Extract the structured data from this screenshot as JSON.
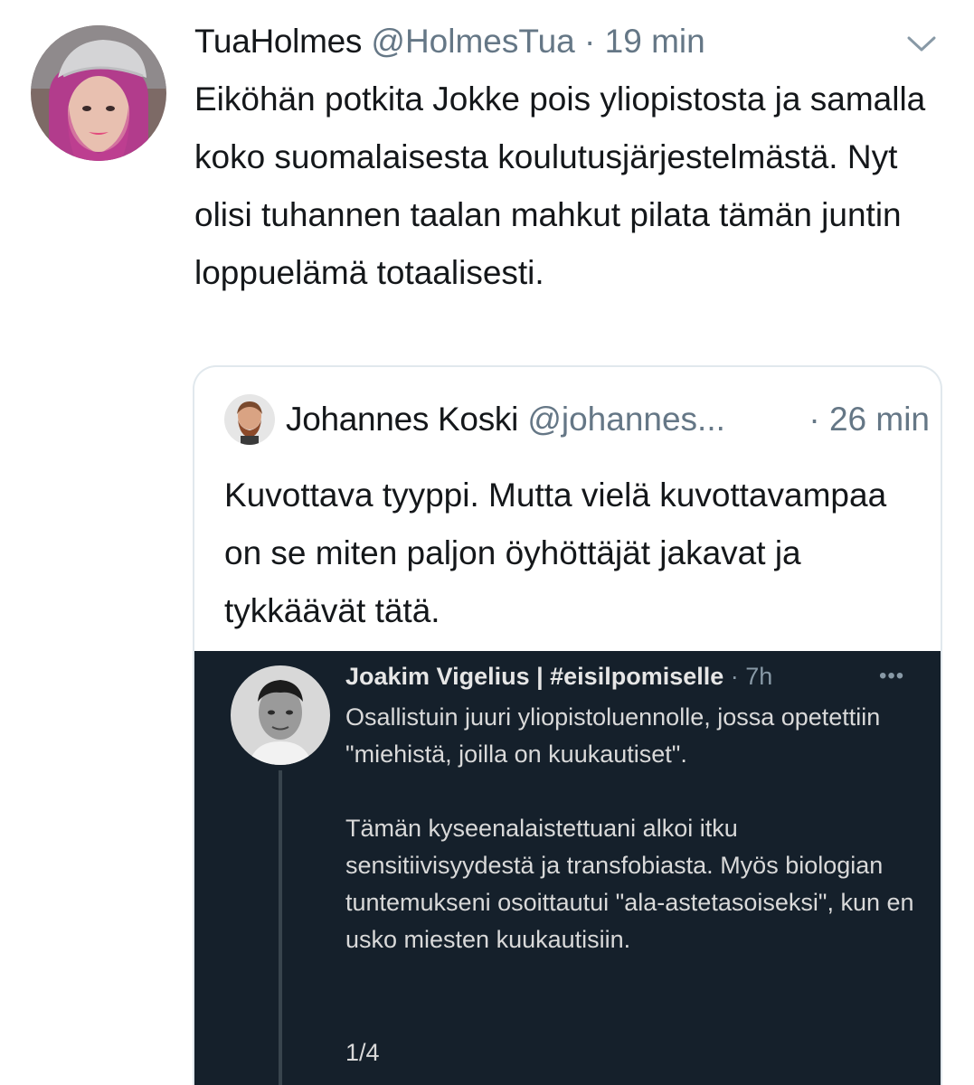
{
  "tweet": {
    "display_name": "TuaHolmes",
    "handle": "@HolmesTua",
    "separator": "·",
    "time": "19 min",
    "more_icon": "chevron-down-icon",
    "text": "Eiköhän potkita Jokke pois yliopistosta ja samalla koko suomalaisesta koulutusjärjestelmästä. Nyt olisi tuhannen taalan mahkut pilata tämän juntin loppuelämä totaalisesti."
  },
  "quote": {
    "display_name": "Johannes Koski",
    "handle": "@johannes...",
    "time": "· 26 min",
    "text": "Kuvottava tyyppi. Mutta vielä kuvottavampaa on se miten paljon öyhöttäjät jakavat ja tykkäävät tätä.",
    "embedded": {
      "display_name": "Joakim Vigelius | #eisilpomiselle",
      "time": "· 7h",
      "more_label": "•••",
      "paragraph_1": "Osallistuin juuri yliopistoluennolle, jossa opetettiin \"miehistä, joilla on kuukautiset\".",
      "paragraph_2": "Tämän kyseenalaistettuani alkoi itku sensitiivisyydestä ja transfobiasta. Myös biologian tuntemukseni osoittautui \"ala-astetasoiseksi\", kun en usko miesten kuukautisiin.",
      "thread_count": "1/4"
    }
  },
  "colors": {
    "text_primary": "#14171a",
    "text_secondary": "#657786",
    "border": "#e1e8ed",
    "dark_background": "#15202b"
  }
}
